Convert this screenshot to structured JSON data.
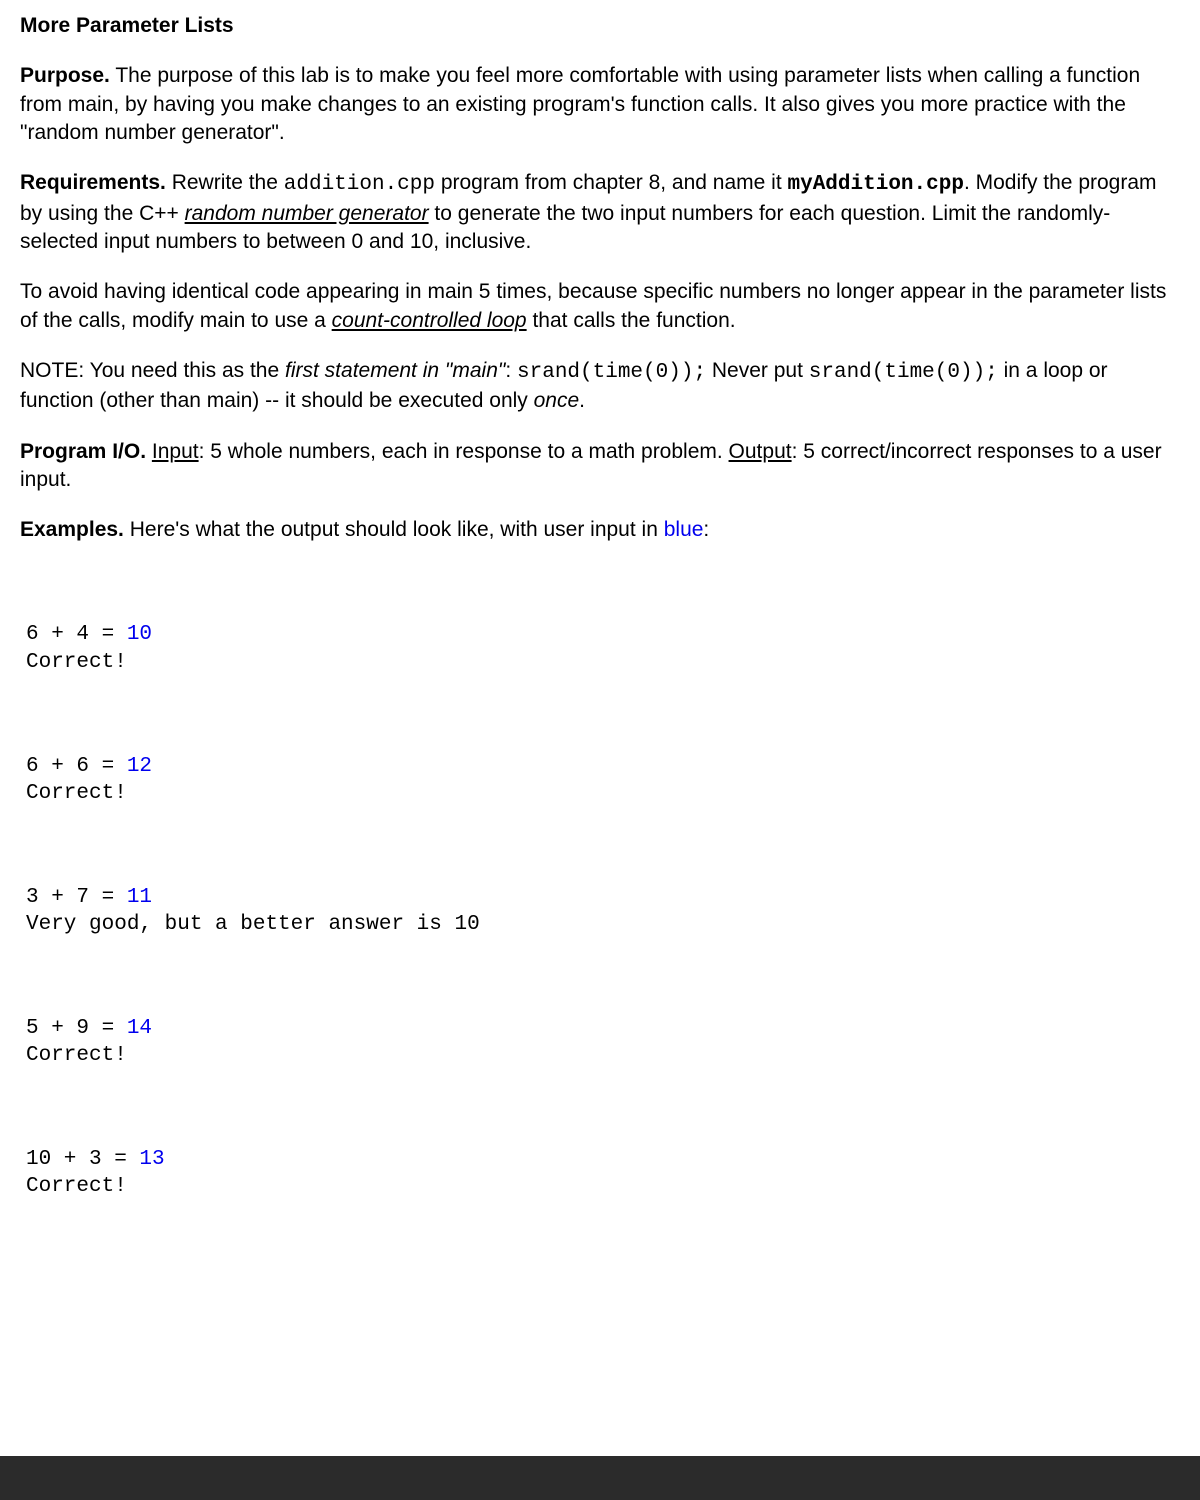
{
  "title": "More Parameter Lists",
  "purpose": {
    "label": "Purpose.",
    "text": " The purpose of this lab is to make you feel more comfortable with using parameter lists when calling a function from main, by having you make changes to an existing program's function calls. It also gives you more practice with the \"random number generator\"."
  },
  "requirements": {
    "label": "Requirements.",
    "text1": " Rewrite the ",
    "code1": "addition.cpp",
    "text2": " program from chapter 8, and name it ",
    "code2": "myAddition.cpp",
    "text3": ". Modify the program by using the C++ ",
    "rng": "random number generator",
    "text4": " to generate the two input numbers for each question. Limit the randomly-selected input numbers to between 0 and 10, inclusive."
  },
  "loop_para": {
    "text1": "To avoid having identical code appearing in main 5 times, because specific numbers no longer appear in the parameter lists of the calls, modify main to use a ",
    "loop": "count-controlled loop",
    "text2": " that calls the function."
  },
  "note": {
    "text1": "NOTE: You need this as the ",
    "first": "first statement in \"main\"",
    "text2": ": ",
    "code1": "srand(time(0));",
    "text3": " Never put ",
    "code2": "srand(time(0));",
    "text4": " in a loop or function (other than main) -- it should be executed only ",
    "once": "once",
    "text5": "."
  },
  "io": {
    "label": "Program I/O.",
    "input_label": "Input",
    "input_text": ": 5 whole numbers, each in response to a math problem.  ",
    "output_label": "Output",
    "output_text": ":  5 correct/incorrect responses to a user input."
  },
  "examples": {
    "label": "Examples.",
    "text1": " Here's what the output should look like, with user input in ",
    "blue_word": "blue",
    "text2": ":"
  },
  "output": [
    {
      "prompt": "6 + 4 = ",
      "input": "10",
      "response": "Correct!"
    },
    {
      "prompt": "6 + 6 = ",
      "input": "12",
      "response": "Correct!"
    },
    {
      "prompt": "3 + 7 = ",
      "input": "11",
      "response": "Very good, but a better answer is 10"
    },
    {
      "prompt": "5 + 9 = ",
      "input": "14",
      "response": "Correct!"
    },
    {
      "prompt": "10 + 3 = ",
      "input": "13",
      "response": "Correct!"
    }
  ]
}
